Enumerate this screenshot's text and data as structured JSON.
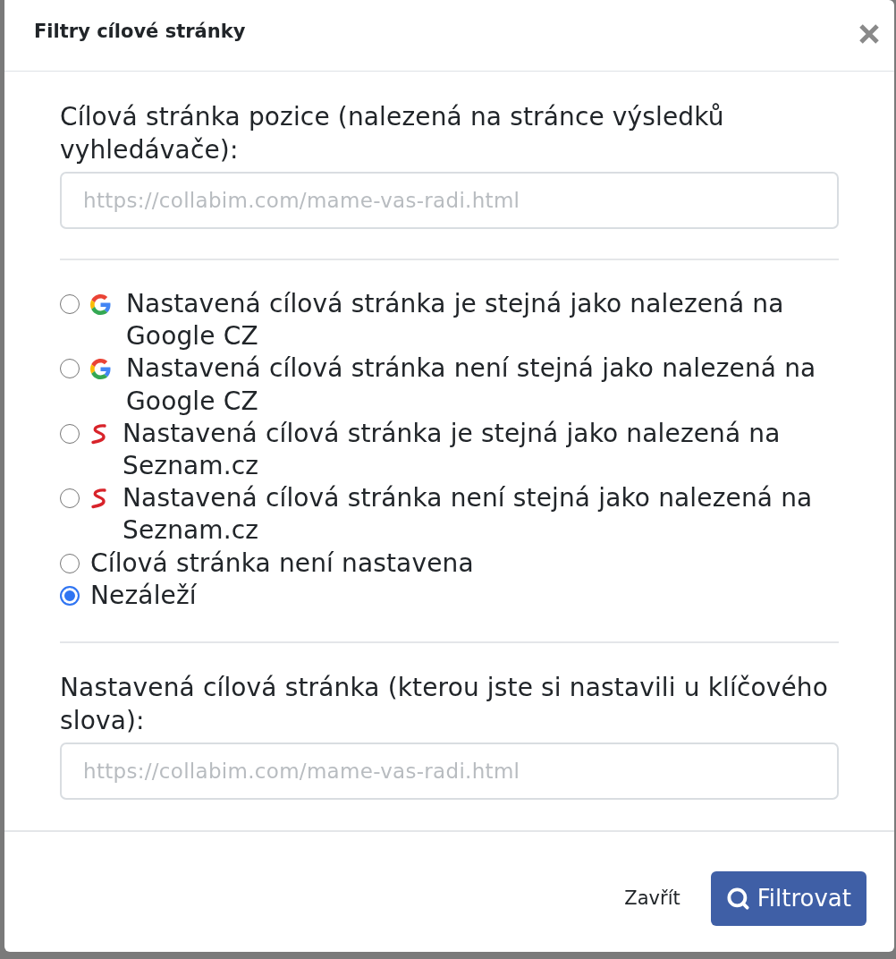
{
  "dialog": {
    "title": "Filtry cílové stránky"
  },
  "sections": [
    {
      "kind": "field",
      "label": "Cílová stránka pozice (nalezená na stránce výsledků vyhledávače):",
      "placeholder": "https://collabim.com/mame-vas-radi.html"
    },
    {
      "kind": "radios",
      "options": [
        {
          "kind": "google",
          "label": "Nastavená cílová stránka je stejná jako nalezená na Google CZ",
          "selected": false
        },
        {
          "kind": "google",
          "label": "Nastavená cílová stránka není stejná jako nalezená na Google CZ",
          "selected": false
        },
        {
          "kind": "seznam",
          "label": "Nastavená cílová stránka je stejná jako nalezená na Seznam.cz",
          "selected": false
        },
        {
          "kind": "seznam",
          "label": "Nastavená cílová stránka není stejná jako nalezená na Seznam.cz",
          "selected": false
        },
        {
          "kind": "plain",
          "label": "Cílová stránka není nastavena",
          "selected": false
        },
        {
          "kind": "plain",
          "label": "Nezáleží",
          "selected": true
        }
      ]
    },
    {
      "kind": "field",
      "label": "Nastavená cílová stránka (kterou jste si nastavili u klíčového slova):",
      "placeholder": "https://collabim.com/mame-vas-radi.html"
    }
  ],
  "footer": {
    "buttons": [
      {
        "kind": "link",
        "label": "Zavřít"
      },
      {
        "kind": "primary",
        "label": "Filtrovat"
      }
    ]
  }
}
